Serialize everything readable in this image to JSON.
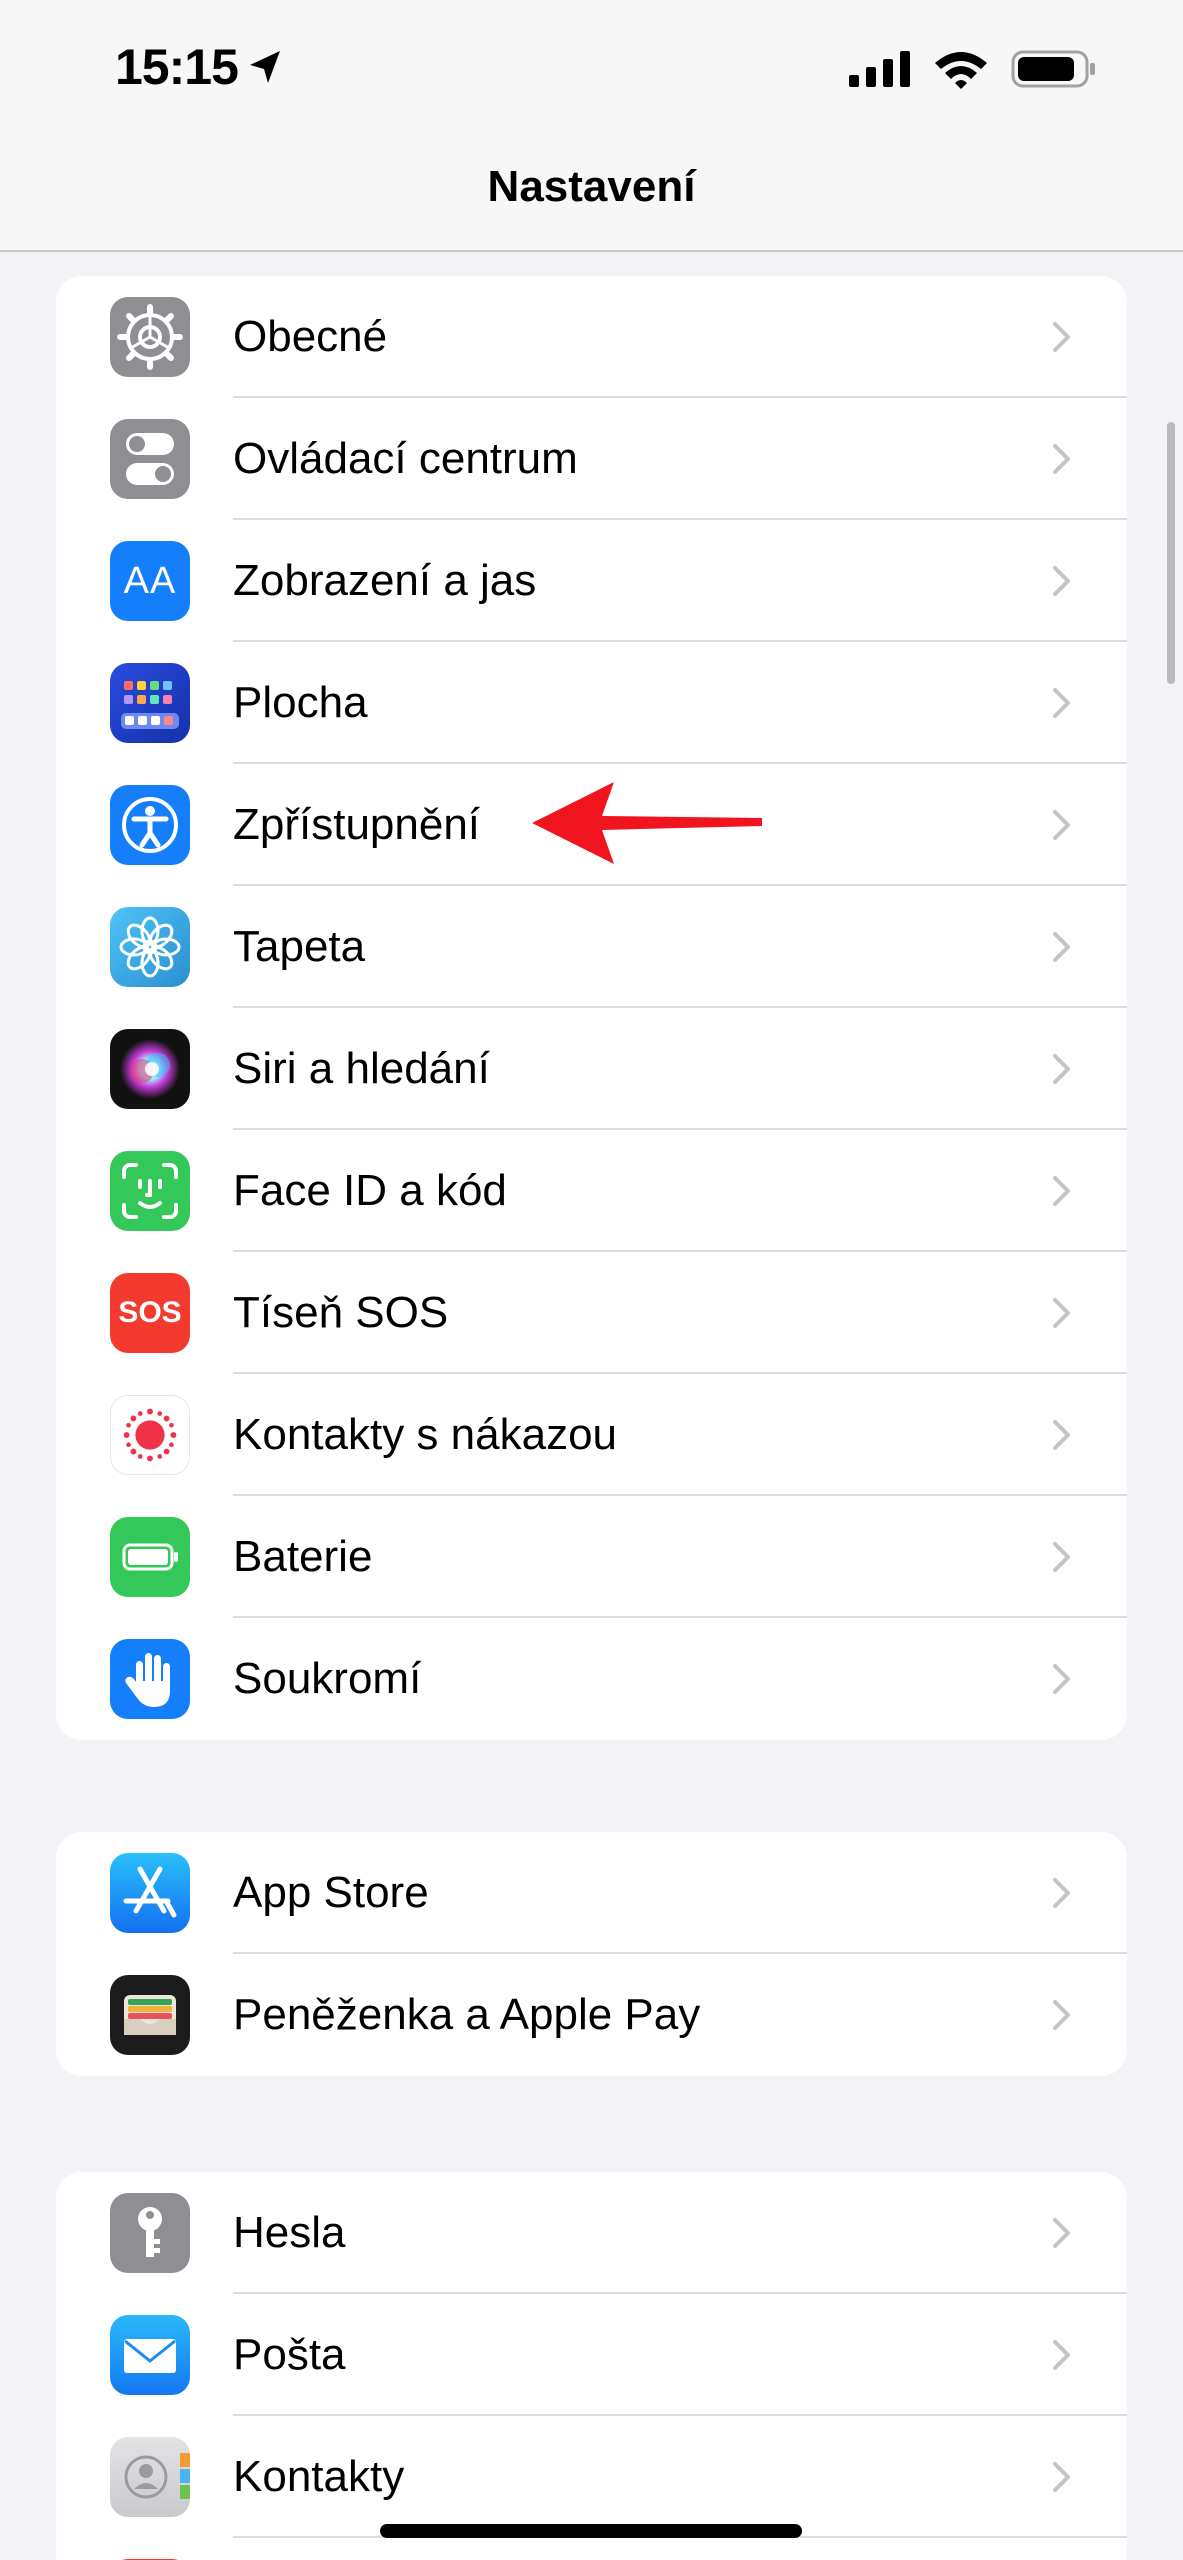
{
  "status_bar": {
    "time": "15:15"
  },
  "nav": {
    "title": "Nastavení"
  },
  "groups": [
    {
      "items": [
        {
          "label": "Obecné",
          "icon": "gear-icon",
          "color": "#8E8E93"
        },
        {
          "label": "Ovládací centrum",
          "icon": "toggles-icon",
          "color": "#8E8E93"
        },
        {
          "label": "Zobrazení a jas",
          "icon": "text-size-icon",
          "color": "#147EFB",
          "icon_text": "AA"
        },
        {
          "label": "Plocha",
          "icon": "home-screen-grid-icon",
          "color": "#1B3FC9"
        },
        {
          "label": "Zpřístupnění",
          "icon": "accessibility-icon",
          "color": "#147EFB"
        },
        {
          "label": "Tapeta",
          "icon": "wallpaper-flower-icon",
          "color": "#38A9E0"
        },
        {
          "label": "Siri a hledání",
          "icon": "siri-icon",
          "color": "#1C1C28"
        },
        {
          "label": "Face ID a kód",
          "icon": "face-id-icon",
          "color": "#34C759"
        },
        {
          "label": "Tíseň SOS",
          "icon": "sos-icon",
          "color": "#F23A2F",
          "icon_text": "SOS"
        },
        {
          "label": "Kontakty s nákazou",
          "icon": "exposure-notification-icon",
          "color": "#FFFFFF"
        },
        {
          "label": "Baterie",
          "icon": "battery-icon",
          "color": "#34C759"
        },
        {
          "label": "Soukromí",
          "icon": "hand-icon",
          "color": "#147EFB"
        }
      ]
    },
    {
      "items": [
        {
          "label": "App Store",
          "icon": "app-store-icon",
          "color": "#1A8CFA"
        },
        {
          "label": "Peněženka a Apple Pay",
          "icon": "wallet-icon",
          "color": "#1C1C1E"
        }
      ]
    },
    {
      "items": [
        {
          "label": "Hesla",
          "icon": "key-icon",
          "color": "#8E8E93"
        },
        {
          "label": "Pošta",
          "icon": "mail-icon",
          "color": "#1A8CFA"
        },
        {
          "label": "Kontakty",
          "icon": "contacts-icon",
          "color": "#D1D1D6"
        }
      ]
    }
  ]
}
